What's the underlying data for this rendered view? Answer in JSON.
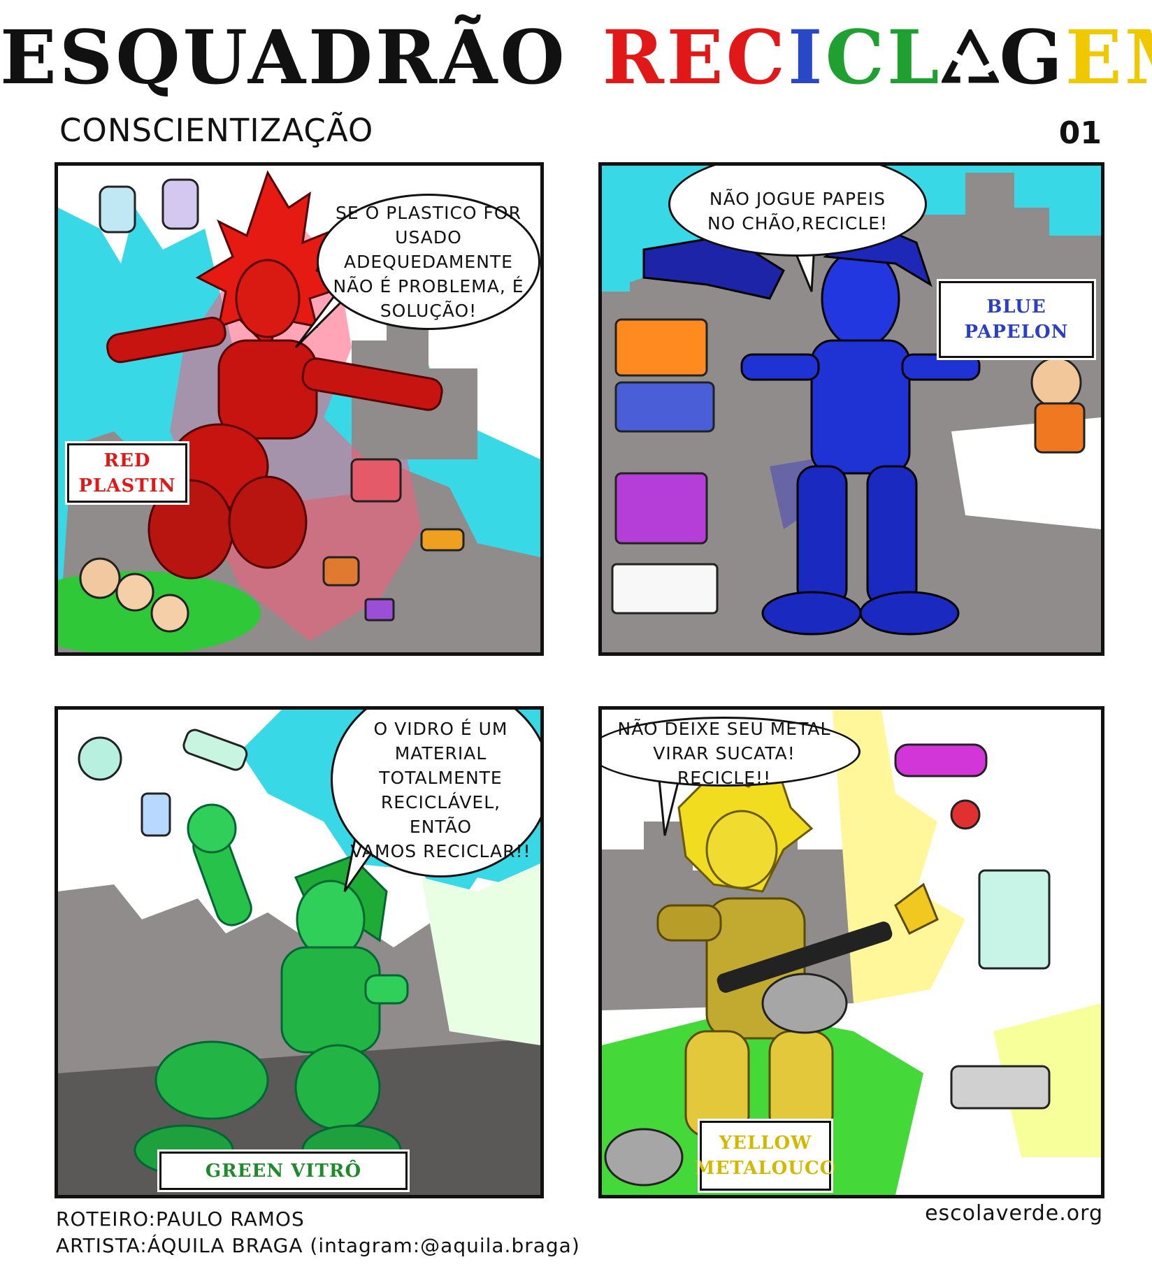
{
  "header": {
    "title_part1": "ESQUADRÃO",
    "title_part2_letters": [
      {
        "char": "R",
        "color": "#e01818"
      },
      {
        "char": "E",
        "color": "#e01818"
      },
      {
        "char": "C",
        "color": "#e01818"
      },
      {
        "char": "I",
        "color": "#2848c8"
      },
      {
        "char": "C",
        "color": "#20a030"
      },
      {
        "char": "L",
        "color": "#20a030"
      },
      {
        "char": "Á",
        "color": "#111111",
        "icon": "recycle-triangle-icon"
      },
      {
        "char": "G",
        "color": "#111111"
      },
      {
        "char": "E",
        "color": "#f0c800"
      },
      {
        "char": "M",
        "color": "#f0c800"
      }
    ],
    "subtitle": "CONSCIENTIZAÇÃO",
    "page_number": "01"
  },
  "panels": [
    {
      "id": "red",
      "hero": "RED PLASTIN",
      "hero_line1": "RED",
      "hero_line2": "PLASTIN",
      "hero_color": "#e01818",
      "speech": "SE O PLASTICO FOR USADO ADEQUEDAMENTE NÃO É PROBLEMA, É SOLUÇÃO!",
      "speech_lines": [
        "SE O PLASTICO FOR",
        "USADO ADEQUEDAMENTE",
        "NÃO É PROBLEMA, É",
        "SOLUÇÃO!"
      ]
    },
    {
      "id": "blue",
      "hero_line1": "BLUE",
      "hero_line2": "PAPELON",
      "hero_color": "#2a3fc4",
      "speech_lines": [
        "NÃO JOGUE PAPEIS",
        "NO CHÃO,RECICLE!"
      ]
    },
    {
      "id": "green",
      "hero_line1": "GREEN VITRÔ",
      "hero_line2": "",
      "hero_color": "#1e8a2c",
      "speech_lines": [
        "O VIDRO É UM",
        "MATERIAL",
        "TOTALMENTE",
        "RECICLÁVEL, ENTÃO",
        "VAMOS RECICLAR!!"
      ]
    },
    {
      "id": "yellow",
      "hero_line1": "YELLOW",
      "hero_line2": "METALOUCO",
      "hero_color": "#d4b800",
      "speech_lines": [
        "NÃO DEIXE SEU METAL",
        "VIRAR SUCATA! RECICLE!!"
      ]
    }
  ],
  "credits": {
    "script": "ROTEIRO:PAULO RAMOS",
    "artist": "ARTISTA:ÁQUILA BRAGA (intagram:@aquila.braga)",
    "site": "escolaverde.org"
  }
}
